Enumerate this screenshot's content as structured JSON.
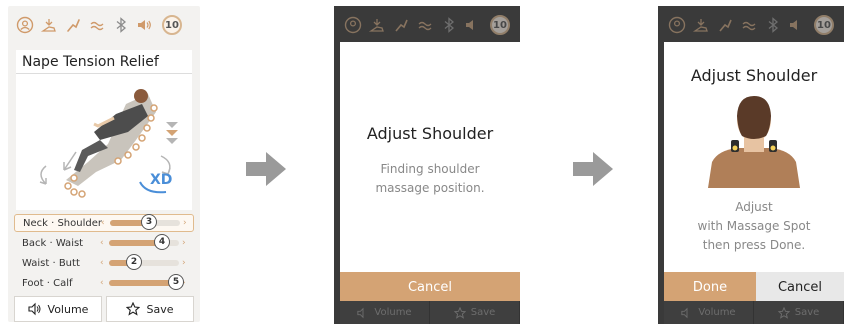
{
  "colors": {
    "accent": "#d4a374",
    "dark_overlay": "#3a3a3a",
    "cancel_gray": "#e8e8e8"
  },
  "topbar": {
    "icons": [
      "user-icon",
      "massage-hand-icon",
      "leg-icon",
      "heat-icon",
      "bluetooth-icon",
      "speaker-icon"
    ],
    "timer": "10"
  },
  "screen1": {
    "program_title": "Nape Tension Relief",
    "xd_label": "XD",
    "sliders": [
      {
        "label": "Neck · Shoulder",
        "value": "3",
        "level": 0.55
      },
      {
        "label": "Back · Waist",
        "value": "4",
        "level": 0.75
      },
      {
        "label": "Waist · Butt",
        "value": "2",
        "level": 0.35
      },
      {
        "label": "Foot · Calf",
        "value": "5",
        "level": 0.95
      }
    ],
    "volume_label": "Volume",
    "save_label": "Save"
  },
  "screen2": {
    "title": "Adjust Shoulder",
    "message_line1": "Finding shoulder",
    "message_line2": "massage position.",
    "cancel_label": "Cancel",
    "volume_label": "Volume",
    "save_label": "Save"
  },
  "screen3": {
    "title": "Adjust Shoulder",
    "message_line1": "Adjust",
    "message_line2": "with Massage Spot",
    "message_line3": "then press Done.",
    "done_label": "Done",
    "cancel_label": "Cancel",
    "volume_label": "Volume",
    "save_label": "Save"
  }
}
